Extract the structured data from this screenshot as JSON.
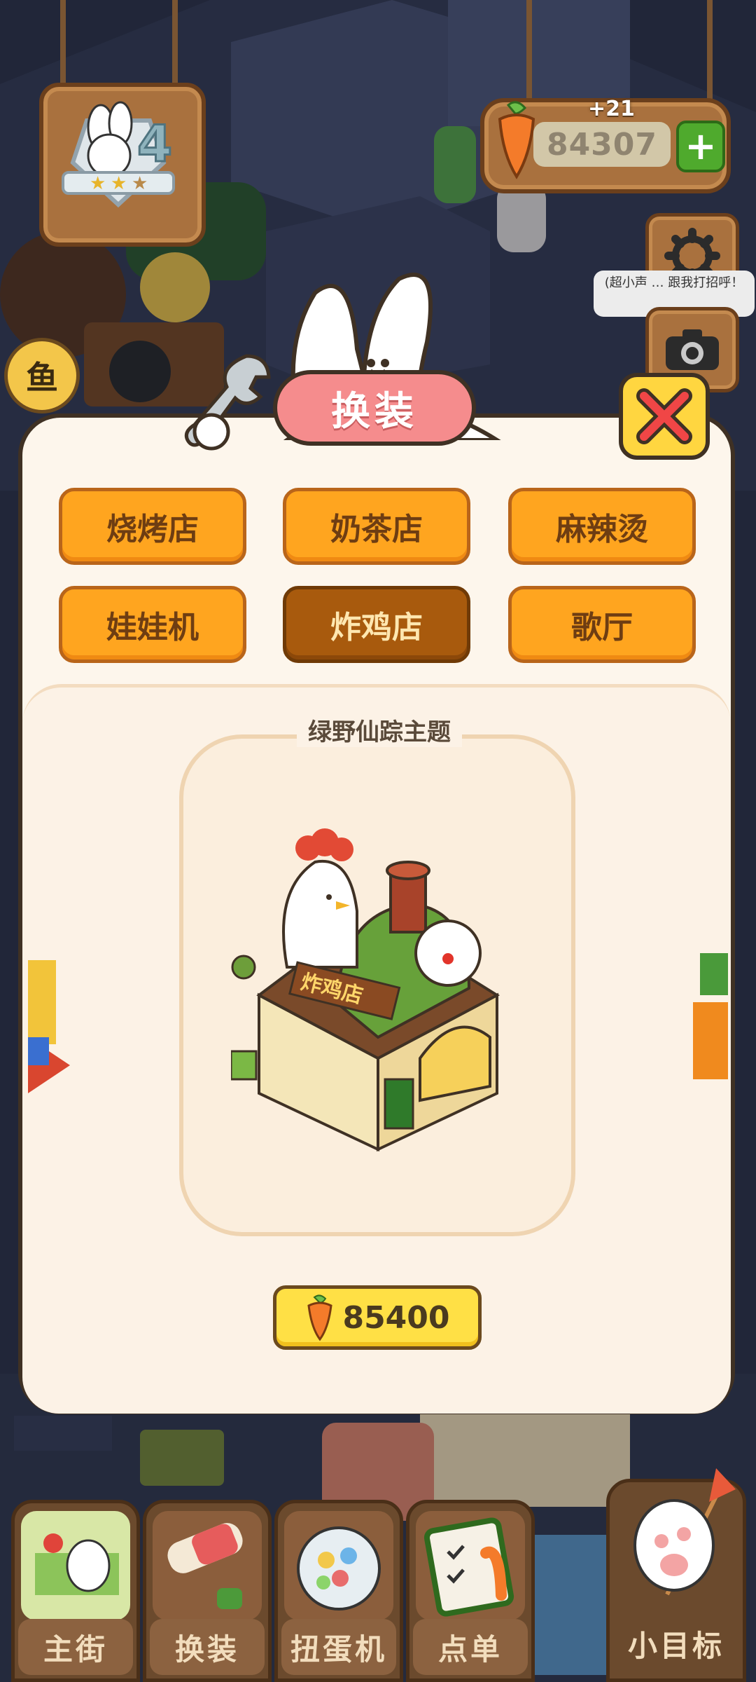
{
  "hud": {
    "level": "4",
    "currency_value": "84307",
    "currency_bonus": "+21",
    "plus_icon": "plus-icon",
    "speech_text": "(超小声 … 跟我打招呼！",
    "fish_badge_glyph": "鱼"
  },
  "modal": {
    "title": "换装",
    "categories": [
      {
        "label": "烧烤店",
        "selected": false
      },
      {
        "label": "奶茶店",
        "selected": false
      },
      {
        "label": "麻辣烫",
        "selected": false
      },
      {
        "label": "娃娃机",
        "selected": false
      },
      {
        "label": "炸鸡店",
        "selected": true
      },
      {
        "label": "歌厅",
        "selected": false
      }
    ],
    "theme_name": "绿野仙踪主题",
    "shop_sign_text": "炸鸡店",
    "price": "85400"
  },
  "bottom_nav": {
    "items": [
      {
        "label": "主街",
        "icon": "map-icon"
      },
      {
        "label": "换装",
        "icon": "paint-roller-icon"
      },
      {
        "label": "扭蛋机",
        "icon": "gacha-machine-icon"
      },
      {
        "label": "点单",
        "icon": "order-list-icon"
      }
    ],
    "goal_label": "小目标"
  },
  "colors": {
    "category_bg": "#ffa51f",
    "category_selected_bg": "#a85a0d",
    "title_pill": "#f58c8d",
    "close_button": "#ffd640",
    "price_button": "#ffe045",
    "modal_bg": "#fdf6ec"
  }
}
